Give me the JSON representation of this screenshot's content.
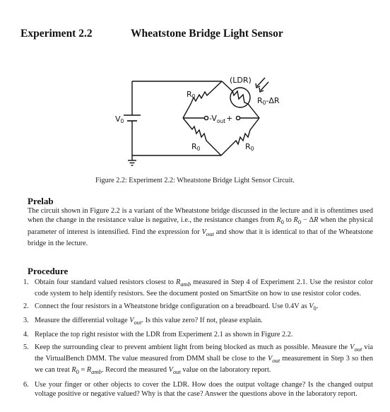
{
  "header": {
    "experiment_number": "Experiment 2.2",
    "experiment_title": "Wheatstone Bridge Light Sensor"
  },
  "figure": {
    "labels": {
      "source": "V",
      "source_sub": "0",
      "ldr": "(LDR)",
      "r_top_left": "R",
      "r_top_left_sub": "0",
      "r_ldr": "R",
      "r_ldr_sub": "0",
      "r_ldr_suffix": "-ΔR",
      "r_bottom_left": "R",
      "r_bottom_left_sub": "0",
      "r_bottom_right": "R",
      "r_bottom_right_sub": "0",
      "vout_minus": "-V",
      "vout_sub": "out",
      "vout_plus": "+"
    },
    "caption": "Figure 2.2:  Experiment 2.2: Wheatstone Bridge Light Sensor Circuit."
  },
  "prelab": {
    "heading": "Prelab",
    "text_html": "The circuit shown in Figure 2.2 is a variant of the Wheatstone bridge discussed in the lecture and it is oftentimes used when the change in the resistance value is negative, i.e., the resistance changes from <i>R</i><sub>0</sub> to <i>R</i><sub>0</sub> &minus; &Delta;<i>R</i> when the physical parameter of interest is intensified. Find the expression for <i>V<sub>out</sub></i> and show that it is identical to that of the Wheatstone bridge in the lecture."
  },
  "procedure": {
    "heading": "Procedure",
    "steps": [
      {
        "num": "1.",
        "text_html": "Obtain four standard valued resistors closest to <i>R<sub>amb</sub></i> measured in Step 4 of Experiment 2.1. Use the resistor color code system to help identify resistors. See the document posted on SmartSite on how to use resistor color codes."
      },
      {
        "num": "2.",
        "text_html": "Connect the four resistors in a Wheatstone bridge configuration on a breadboard. Use 0.4V as <i>V</i><sub>0</sub>."
      },
      {
        "num": "3.",
        "text_html": "Measure the differential voltage <i>V<sub>out</sub></i>. Is this value zero? If not, please explain."
      },
      {
        "num": "4.",
        "text_html": "Replace the top right resistor with the LDR from Experiment 2.1 as shown in Figure 2.2."
      },
      {
        "num": "5.",
        "text_html": "Keep the surrounding clear to prevent ambient light from being blocked as much as possible. Measure the <i>V<sub>out</sub></i> via the VirtualBench DMM. The value measured from DMM shall be close to the <i>V<sub>out</sub></i> measurement in Step 3 so then we can treat <i>R</i><sub>0</sub> = <i>R<sub>amb</sub></i>. Record the measured <i>V<sub>out</sub></i> value on the laboratory report."
      },
      {
        "num": "6.",
        "text_html": "Use your finger or other objects to cover the LDR. How does the output voltage change?  Is the changed output voltage positive or negative valued?  Why is that the case?  Answer the questions above in the laboratory report."
      }
    ]
  }
}
